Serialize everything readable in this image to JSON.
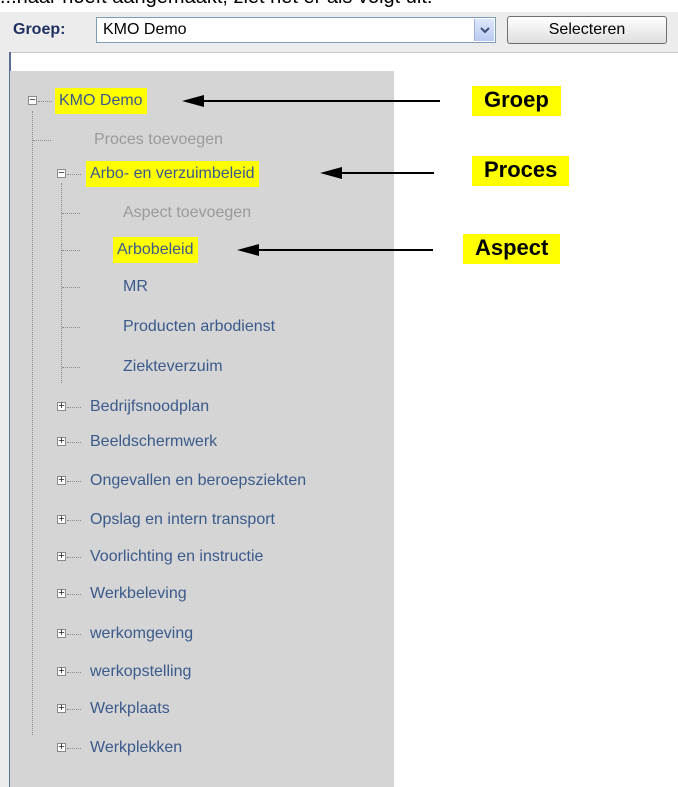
{
  "caption_fragment": "...naar hoeft aangemaakt, ziet het er als volgt uit:",
  "toolbar": {
    "group_label": "Groep:",
    "group_select_value": "KMO Demo",
    "select_button": "Selecteren"
  },
  "tree": {
    "root": "KMO Demo",
    "add_process": "Proces toevoegen",
    "expanded_process": "Arbo- en verzuimbeleid",
    "add_aspect": "Aspect toevoegen",
    "aspects": [
      "Arbobeleid",
      "MR",
      "Producten arbodienst",
      "Ziekteverzuim"
    ],
    "collapsed_processes": [
      "Bedrijfsnoodplan",
      "Beeldschermwerk",
      "Ongevallen en beroepsziekten",
      "Opslag en intern transport",
      "Voorlichting en instructie",
      "Werkbeleving",
      "werkomgeving",
      "werkopstelling",
      "Werkplaats",
      "Werkplekken"
    ]
  },
  "annotations": {
    "groep": "Groep",
    "proces": "Proces",
    "aspect": "Aspect"
  },
  "colors": {
    "highlight": "#ffff00",
    "link_text": "#3a5a8c",
    "panel_bg": "#d5d5d5"
  }
}
